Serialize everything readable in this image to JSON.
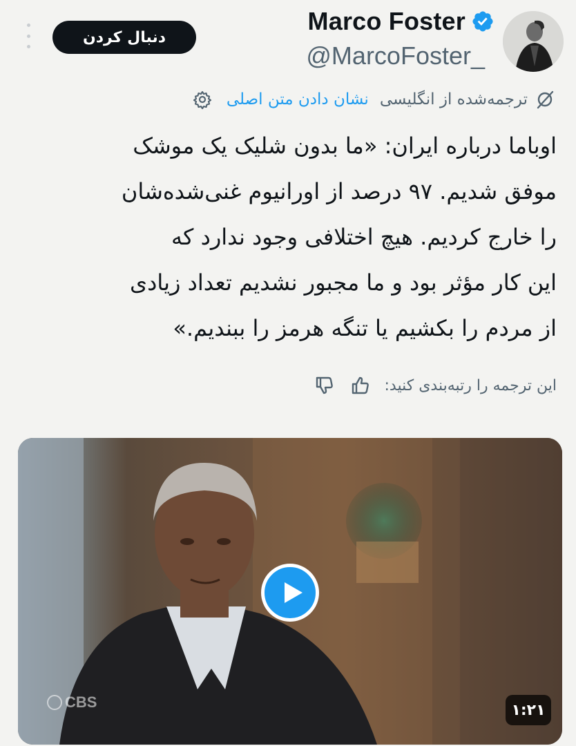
{
  "author": {
    "display_name": "Marco Foster",
    "handle": "@MarcoFoster_",
    "verified": true,
    "verified_color": "#1d9bf0"
  },
  "follow_button": {
    "label": "دنبال کردن",
    "bg": "#0f1419"
  },
  "more_menu": {
    "icon": "more-vertical-icon"
  },
  "translation": {
    "icon": "translate-icon",
    "note": "ترجمه‌شده از انگلیسی",
    "show_original_label": "نشان دادن متن اصلی",
    "settings_icon": "gear-icon",
    "link_color": "#1d9bf0"
  },
  "tweet": {
    "lines": [
      "اوباما درباره ایران: «ما بدون شلیک یک موشک",
      "موفق شدیم. ۹۷ درصد از اورانیوم غنی‌شده‌شان",
      "را خارج کردیم. هیچ اختلافی وجود ندارد که",
      "این کار مؤثر بود و ما مجبور نشدیم تعداد زیادی",
      "از مردم را بکشیم یا تنگه هرمز را ببندیم.»"
    ]
  },
  "rating": {
    "prompt": "این ترجمه را رتبه‌بندی کنید:",
    "thumbs_up_icon": "thumbs-up-icon",
    "thumbs_down_icon": "thumbs-down-icon"
  },
  "media": {
    "type": "video",
    "duration": "۱:۲۱",
    "watermark": "CBS",
    "play_icon": "play-icon",
    "play_color": "#1d9bf0"
  }
}
